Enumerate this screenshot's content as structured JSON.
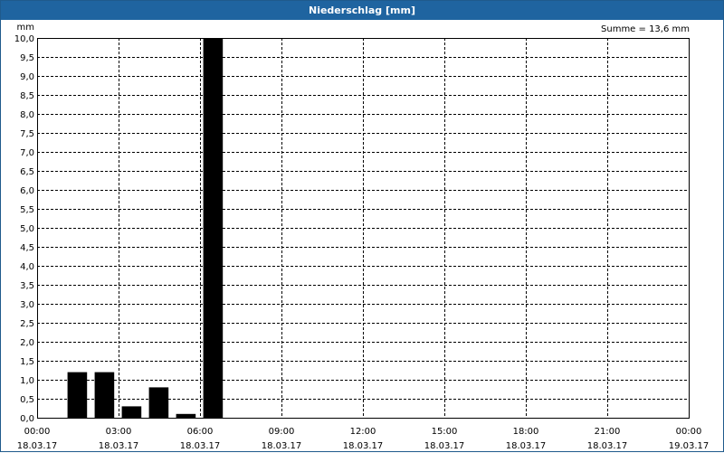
{
  "window": {
    "title": "Niederschlag [mm]"
  },
  "summary": {
    "label": "Summe = 13,6 mm"
  },
  "chart_data": {
    "type": "bar",
    "title": "Niederschlag [mm]",
    "ylabel": "mm",
    "xlabel": "",
    "ylim": [
      0,
      10
    ],
    "y_step": 0.5,
    "y_ticks": [
      "0,0",
      "0,5",
      "1,0",
      "1,5",
      "2,0",
      "2,5",
      "3,0",
      "3,5",
      "4,0",
      "4,5",
      "5,0",
      "5,5",
      "6,0",
      "6,5",
      "7,0",
      "7,5",
      "8,0",
      "8,5",
      "9,0",
      "9,5",
      "10,0"
    ],
    "x_range_hours": [
      0,
      24
    ],
    "x_ticks": [
      {
        "time": "00:00",
        "date": "18.03.17"
      },
      {
        "time": "03:00",
        "date": "18.03.17"
      },
      {
        "time": "06:00",
        "date": "18.03.17"
      },
      {
        "time": "09:00",
        "date": "18.03.17"
      },
      {
        "time": "12:00",
        "date": "18.03.17"
      },
      {
        "time": "15:00",
        "date": "18.03.17"
      },
      {
        "time": "18:00",
        "date": "18.03.17"
      },
      {
        "time": "21:00",
        "date": "18.03.17"
      },
      {
        "time": "00:00",
        "date": "19.03.17"
      }
    ],
    "bars": [
      {
        "start": "01:00",
        "end": "02:00",
        "value": 1.2
      },
      {
        "start": "02:00",
        "end": "03:00",
        "value": 1.2
      },
      {
        "start": "03:00",
        "end": "04:00",
        "value": 0.3
      },
      {
        "start": "04:00",
        "end": "05:00",
        "value": 0.8
      },
      {
        "start": "05:00",
        "end": "06:00",
        "value": 0.1
      },
      {
        "start": "06:00",
        "end": "07:00",
        "value": 10.0
      }
    ],
    "grid": true,
    "bar_color": "#000000",
    "grid_color": "#000000"
  }
}
